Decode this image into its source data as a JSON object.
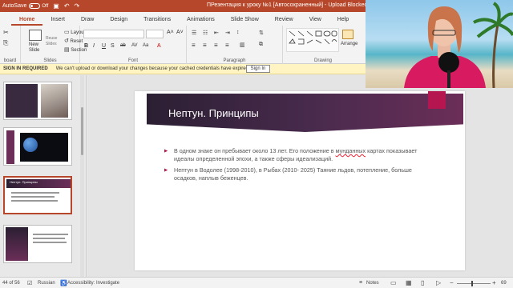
{
  "titlebar": {
    "autosave_label": "AutoSave",
    "autosave_state": "Off",
    "document_title": "ПРезентация к уроку №1 [Автосохраненный] - Upload Blocked"
  },
  "tabs": [
    "Home",
    "Insert",
    "Draw",
    "Design",
    "Transitions",
    "Animations",
    "Slide Show",
    "Review",
    "View",
    "Help"
  ],
  "ribbon": {
    "clipboard_label": "board",
    "new_slide_label": "New\nSlide",
    "reuse_slides_label": "Reuse\nSlides",
    "layout_label": "Layout",
    "reset_label": "Reset",
    "section_label": "Section",
    "slides_group_label": "Slides",
    "font_group_label": "Font",
    "paragraph_group_label": "Paragraph",
    "drawing_group_label": "Drawing",
    "arrange_label": "Arrange",
    "font_buttons": [
      "B",
      "I",
      "U",
      "S",
      "ab",
      "AV",
      "Aa"
    ],
    "paragraph_align": [
      "≡",
      "≡",
      "≡",
      "≡"
    ]
  },
  "messagebar": {
    "title": "SIGN IN REQUIRED",
    "text": "We can't upload or download your changes because your cached credentials have expired.",
    "button": "Sign In"
  },
  "thumbnails": {
    "slide_numbers": [
      "",
      "",
      "",
      ""
    ],
    "selected_title": "Нептун. Принципы"
  },
  "slide": {
    "title": "Нептун. Принципы",
    "bullet1_a": "В одном знаке он пребывает около 13 лет. Его положение в ",
    "bullet1_underlined": "мунданных",
    "bullet1_b": " картах показывает идеалы определенной эпохи, а также сферы идеализаций.",
    "bullet2": "Нептун в Водолее (1998-2010), в Рыбах (2010- 2025) Таяние льдов, потепление, больше осадков, наплыв беженцев."
  },
  "statusbar": {
    "slide_counter": "44 of 56",
    "language": "Russian",
    "accessibility": "Accessibility: Investigate",
    "notes": "Notes",
    "zoom": "69"
  },
  "colors": {
    "accent": "#b7472a",
    "slide_banner_dark": "#2b1f33",
    "slide_banner_purple": "#6b2e58",
    "slide_accent_magenta": "#b5164f",
    "messagebar_bg": "#fff4c2"
  },
  "icons": [
    "autosave-toggle",
    "save-icon",
    "undo-icon",
    "redo-icon",
    "new-slide-icon",
    "layout-icon",
    "shapes-icon",
    "arrange-icon",
    "notes-icon",
    "normal-view-icon",
    "slide-sorter-icon",
    "reading-view-icon",
    "accessibility-icon"
  ]
}
